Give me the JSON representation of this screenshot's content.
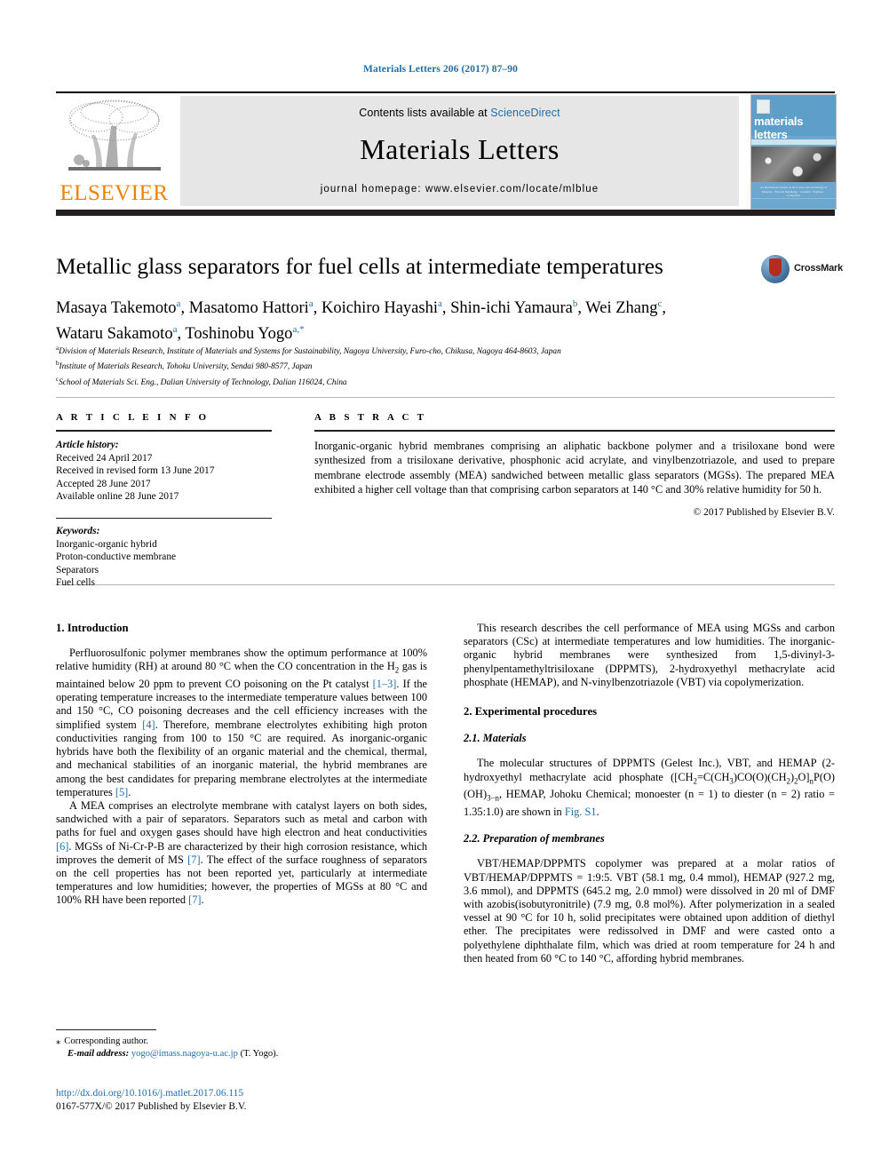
{
  "running_head": "Materials Letters 206 (2017) 87–90",
  "masthead": {
    "publisher": "ELSEVIER",
    "contents_prefix": "Contents lists available at ",
    "contents_link": "ScienceDirect",
    "journal_name": "Materials Letters",
    "homepage": "journal homepage: www.elsevier.com/locate/mlblue",
    "cover_title": "materials letters",
    "cover_caption": "An International Journal on the Science and Technology of Materials · Physical Metallurgy · Ceramics · Polymers · Composites"
  },
  "article": {
    "title": "Metallic glass separators for fuel cells at intermediate temperatures",
    "crossmark_label": "CrossMark",
    "authors_line_1": "Masaya Takemoto a, Masatomo Hattori a, Koichiro Hayashi a, Shin-ichi Yamaura b, Wei Zhang c,",
    "authors_line_2": "Wataru Sakamoto a, Toshinobu Yogo a,*",
    "affiliations": [
      {
        "marker": "a",
        "text": "Division of Materials Research, Institute of Materials and Systems for Sustainability, Nagoya University, Furo-cho, Chikusa, Nagoya 464-8603, Japan"
      },
      {
        "marker": "b",
        "text": "Institute of Materials Research, Tohoku University, Sendai 980-8577, Japan"
      },
      {
        "marker": "c",
        "text": "School of Materials Sci. Eng., Dalian University of Technology, Dalian 116024, China"
      }
    ]
  },
  "info_panel": {
    "heading": "A R T I C L E  I N F O",
    "history_label": "Article history:",
    "history": [
      "Received 24 April 2017",
      "Received in revised form 13 June 2017",
      "Accepted 28 June 2017",
      "Available online 28 June 2017"
    ],
    "keywords_label": "Keywords:",
    "keywords": [
      "Inorganic-organic hybrid",
      "Proton-conductive membrane",
      "Separators",
      "Fuel cells"
    ]
  },
  "abstract_panel": {
    "heading": "A B S T R A C T",
    "text": "Inorganic-organic hybrid membranes comprising an aliphatic backbone polymer and a trisiloxane bond were synthesized from a trisiloxane derivative, phosphonic acid acrylate, and vinylbenzotriazole, and used to prepare membrane electrode assembly (MEA) sandwiched between metallic glass separators (MGSs). The prepared MEA exhibited a higher cell voltage than that comprising carbon separators at 140 °C and 30% relative humidity for 50 h.",
    "copyright": "© 2017 Published by Elsevier B.V."
  },
  "body": {
    "left": {
      "section_1_heading": "1. Introduction",
      "para_1_a": "Perfluorosulfonic polymer membranes show the optimum performance at 100% relative humidity (RH) at around 80 °C when the CO concentration in the H",
      "para_1_b": " gas is maintained below 20 ppm to prevent CO poisoning on the Pt catalyst ",
      "ref_1_3": "[1–3]",
      "para_1_c": ". If the operating temperature increases to the intermediate temperature values between 100 and 150 °C, CO poisoning decreases and the cell efficiency increases with the simplified system ",
      "ref_4": "[4]",
      "para_1_d": ". Therefore, membrane electrolytes exhibiting high proton conductivities ranging from 100 to 150 °C are required. As inorganic-organic hybrids have both the flexibility of an organic material and the chemical, thermal, and mechanical stabilities of an inorganic material, the hybrid membranes are among the best candidates for preparing membrane electrolytes at the intermediate temperatures ",
      "ref_5": "[5]",
      "para_1_e": ".",
      "para_2_a": "A MEA comprises an electrolyte membrane with catalyst layers on both sides, sandwiched with a pair of separators. Separators such as metal and carbon with paths for fuel and oxygen gases should have high electron and heat conductivities ",
      "ref_6": "[6]",
      "para_2_b": ". MGSs of Ni-Cr-P-B are characterized by their high corrosion resistance, which improves the demerit of MS ",
      "ref_7": "[7]",
      "para_2_c": ". The effect of the surface roughness of separators on the cell properties has not been reported yet, particularly at intermediate temperatures and low humidities; however, the properties of MGSs at 80 °C and 100% RH have been reported ",
      "ref_7b": "[7]",
      "para_2_d": "."
    },
    "right": {
      "para_1": "This research describes the cell performance of MEA using MGSs and carbon separators (CSc) at intermediate temperatures and low humidities. The inorganic-organic hybrid membranes were synthesized from 1,5-divinyl-3-phenylpentamethyltrisiloxane (DPPMTS), 2-hydroxyethyl methacrylate acid phosphate (HEMAP), and N-vinylbenzotriazole (VBT) via copolymerization.",
      "section_2_heading": "2. Experimental procedures",
      "subsection_21_heading": "2.1. Materials",
      "para_2_a": "The molecular structures of DPPMTS (Gelest Inc.), VBT, and HEMAP (2-hydroxyethyl methacrylate acid phosphate ([CH",
      "para_2_formula": "2=C(CH3)CO(O)(CH2)2O]nP(O)(OH)3−n",
      "para_2_b": ", HEMAP, Johoku Chemical; monoester (n = 1) to diester (n = 2) ratio = 1.35:1.0) are shown in ",
      "fig_ref": "Fig. S1",
      "para_2_c": ".",
      "subsection_22_heading": "2.2. Preparation of membranes",
      "para_3": "VBT/HEMAP/DPPMTS copolymer was prepared at a molar ratios of VBT/HEMAP/DPPMTS = 1:9:5. VBT (58.1 mg, 0.4 mmol), HEMAP (927.2 mg, 3.6 mmol), and DPPMTS (645.2 mg, 2.0 mmol) were dissolved in 20 ml of DMF with azobis(isobutyronitrile) (7.9 mg, 0.8 mol%). After polymerization in a sealed vessel at 90 °C for 10 h, solid precipitates were obtained upon addition of diethyl ether. The precipitates were redissolved in DMF and were casted onto a polyethylene diphthalate film, which was dried at room temperature for 24 h and then heated from 60 °C to 140 °C, affording hybrid membranes."
    }
  },
  "footer": {
    "corresponding_marker": "⁎",
    "corresponding_label": "Corresponding author.",
    "email_label": "E-mail address:",
    "email": "yogo@imass.nagoya-u.ac.jp",
    "email_suffix": "(T. Yogo).",
    "doi": "http://dx.doi.org/10.1016/j.matlet.2017.06.115",
    "issn_line": "0167-577X/© 2017 Published by Elsevier B.V."
  },
  "colors": {
    "link": "#1f6ea8",
    "elsevier_orange": "#ef8200",
    "band_grey": "#e6e6e6"
  }
}
